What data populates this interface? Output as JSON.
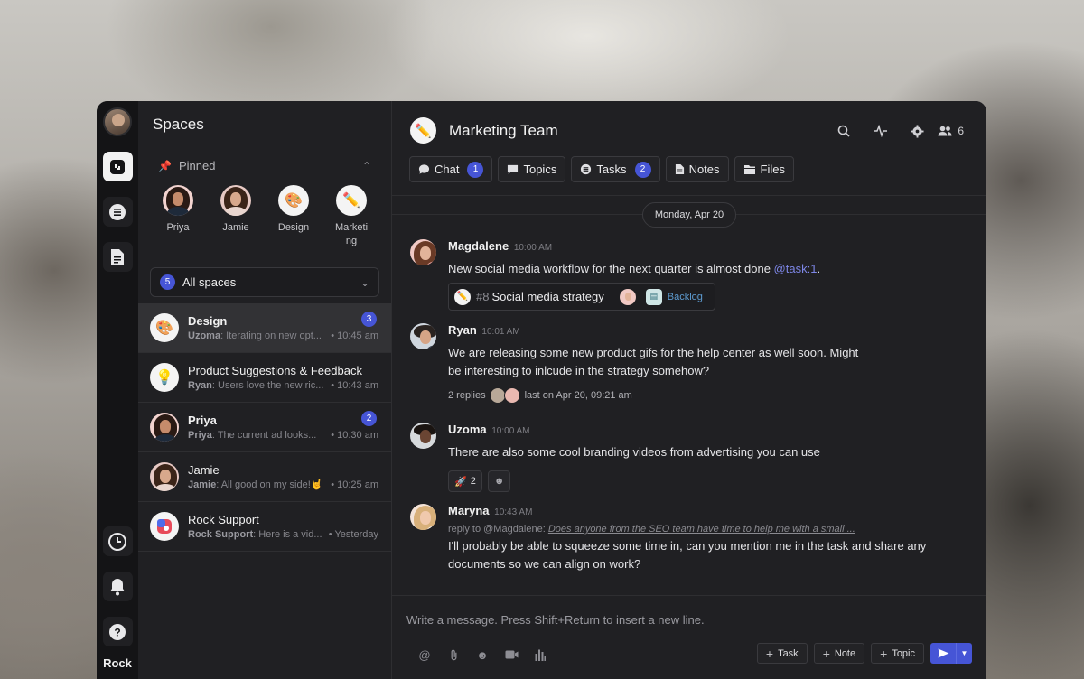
{
  "rail": {
    "brand": "Rock"
  },
  "spaces_panel": {
    "title": "Spaces",
    "pinned_label": "Pinned",
    "pinned": [
      {
        "label": "Priya"
      },
      {
        "label": "Jamie"
      },
      {
        "label": "Design"
      },
      {
        "label": "Marketing"
      }
    ],
    "filter": {
      "count": "5",
      "label": "All spaces"
    },
    "items": [
      {
        "name": "Design",
        "author": "Uzoma",
        "preview": ": Iterating on new opt...",
        "time": " • 10:45 am",
        "badge": "3"
      },
      {
        "name": "Product Suggestions & Feedback",
        "author": "Ryan",
        "preview": ": Users love the new ric...",
        "time": " • 10:43 am",
        "badge": ""
      },
      {
        "name": "Priya",
        "author": "Priya",
        "preview": ": The current ad looks...",
        "time": " • 10:30 am",
        "badge": "2"
      },
      {
        "name": "Jamie",
        "author": "Jamie",
        "preview": ": All good on my side!🤘",
        "time": " • 10:25 am",
        "badge": ""
      },
      {
        "name": "Rock Support",
        "author": "Rock Support",
        "preview": ": Here is a vid...",
        "time": " • Yesterday",
        "badge": ""
      }
    ]
  },
  "header": {
    "title": "Marketing Team",
    "member_count": "6",
    "tabs": [
      {
        "label": "Chat",
        "badge": "1"
      },
      {
        "label": "Topics",
        "badge": ""
      },
      {
        "label": "Tasks",
        "badge": "2"
      },
      {
        "label": "Notes",
        "badge": ""
      },
      {
        "label": "Files",
        "badge": ""
      }
    ]
  },
  "chat": {
    "date": "Monday, Apr 20",
    "messages": [
      {
        "author": "Magdalene",
        "time": "10:00 AM",
        "text": "New social media workflow for the next quarter is almost done ",
        "mention": "@task:1",
        "text_end": ".",
        "task": {
          "number": "#8",
          "title": "Social media strategy",
          "status": "Backlog"
        }
      },
      {
        "author": "Ryan",
        "time": "10:01 AM",
        "text_line1": "We are releasing some new product gifs for the help center as well soon. Might",
        "text_line2": "be interesting to inlcude in the strategy somehow?",
        "replies": "2 replies",
        "last": "last on Apr 20, 09:21 am"
      },
      {
        "author": "Uzoma",
        "time": "10:00 AM",
        "text": "There are also some cool branding videos from advertising you can use",
        "reaction": {
          "emoji": "🚀",
          "count": "2"
        }
      },
      {
        "author": "Maryna",
        "time": "10:43 AM",
        "reply_prefix": "reply to @Magdalene: ",
        "reply_quote": "Does anyone from the SEO team have time to help me with a small ...",
        "text_line1": "I'll probably be able to squeeze some time in, can you mention me in the task and share any",
        "text_line2": "documents so we can align on work?"
      }
    ]
  },
  "composer": {
    "placeholder": "Write a message. Press Shift+Return to insert a new line.",
    "actions": {
      "task": "Task",
      "note": "Note",
      "topic": "Topic"
    }
  }
}
